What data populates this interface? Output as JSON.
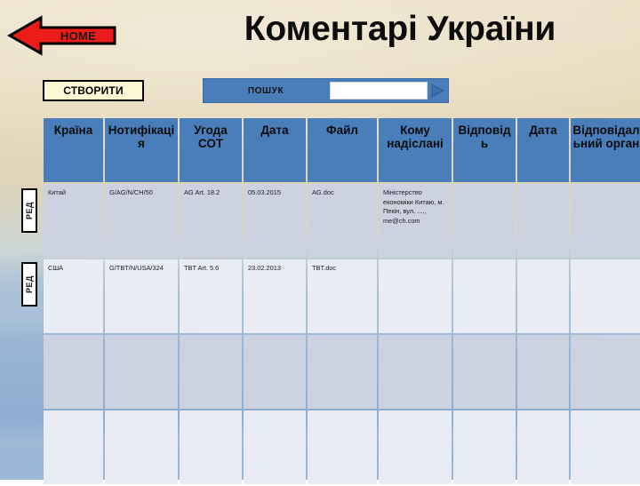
{
  "page": {
    "title": "Коментарі України",
    "background_top_color": "#ece0c6",
    "background_bottom_color": "#93b1d2"
  },
  "nav": {
    "home_label": "HOME",
    "home_icon": "left-arrow-icon",
    "home_color": "#ee1b1b"
  },
  "toolbar": {
    "create_label": "СТВОРИТИ",
    "create_color": "#fdf8d4",
    "search_label": "ПОШУК",
    "search_value": "",
    "search_placeholder": "",
    "search_go_icon": "play-triangle-icon",
    "search_bar_color": "#4a7ebb"
  },
  "side_actions": [
    {
      "label": "РЕД"
    },
    {
      "label": "РЕД"
    }
  ],
  "table": {
    "header_color": "#4a7ebb",
    "columns": [
      "Країна",
      "Нотифікація",
      "Угода СОТ",
      "Дата",
      "Файл",
      "Кому надіслані",
      "Відповідь",
      "Дата",
      "Відповідальний орган"
    ],
    "rows": [
      {
        "cells": [
          "Китай",
          "G/AG/N/CH/50",
          "AG Art. 18.2",
          "05.03.2015",
          "AG.doc",
          "Міністерство економіки Китаю, м. Пекін, вул. ...., me@ch.com",
          "",
          "",
          ""
        ]
      },
      {
        "cells": [
          "США",
          "G/TBT/N/USA/324",
          "TBT Art. 5.6",
          "23.02.2013",
          "TBT.doc",
          "",
          "",
          "",
          ""
        ]
      },
      {
        "cells": [
          "",
          "",
          "",
          "",
          "",
          "",
          "",
          "",
          ""
        ]
      },
      {
        "cells": [
          "",
          "",
          "",
          "",
          "",
          "",
          "",
          "",
          ""
        ]
      }
    ]
  }
}
